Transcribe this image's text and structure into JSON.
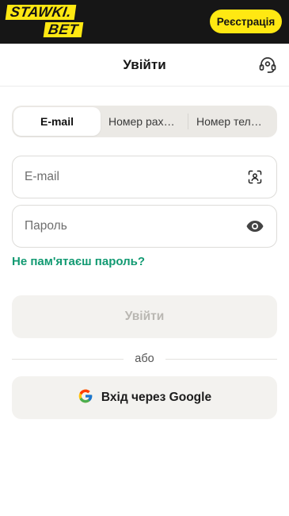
{
  "topbar": {
    "logo_line1": "STAWKI.",
    "logo_line2": "BET",
    "register_label": "Реєстрація"
  },
  "header": {
    "title": "Увійти",
    "support_icon": "headset-icon"
  },
  "tabs": [
    {
      "label": "E-mail",
      "active": true
    },
    {
      "label": "Номер рахунку",
      "active": false
    },
    {
      "label": "Номер телефону",
      "active": false
    }
  ],
  "form": {
    "email_placeholder": "E-mail",
    "email_icon": "face-id-icon",
    "password_placeholder": "Пароль",
    "password_icon": "eye-icon",
    "forgot_label": "Не пам'ятаєш пароль?",
    "login_label": "Увійти",
    "divider_label": "або",
    "google_label": "Вхід через Google"
  },
  "colors": {
    "brand_yellow": "#ffe812",
    "topbar_bg": "#161616",
    "link_green": "#129a72"
  }
}
